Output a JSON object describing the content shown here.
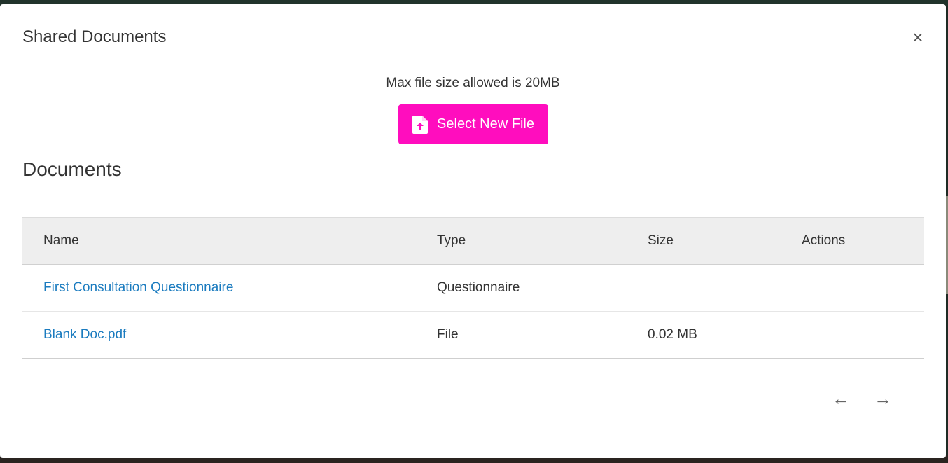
{
  "modal": {
    "title": "Shared Documents",
    "close_label": "×"
  },
  "upload": {
    "max_size_text": "Max file size allowed is 20MB",
    "button_label": "Select New File",
    "button_color": "#ff0dbe",
    "button_icon": "file-upload-icon"
  },
  "documents": {
    "heading": "Documents",
    "columns": [
      "Name",
      "Type",
      "Size",
      "Actions"
    ],
    "rows": [
      {
        "name": "First Consultation Questionnaire",
        "type": "Questionnaire",
        "size": ""
      },
      {
        "name": "Blank Doc.pdf",
        "type": "File",
        "size": "0.02 MB"
      }
    ]
  },
  "pagination": {
    "prev_label": "←",
    "next_label": "→"
  },
  "colors": {
    "link": "#1a7bbf",
    "header_bg": "#eeeeee"
  }
}
